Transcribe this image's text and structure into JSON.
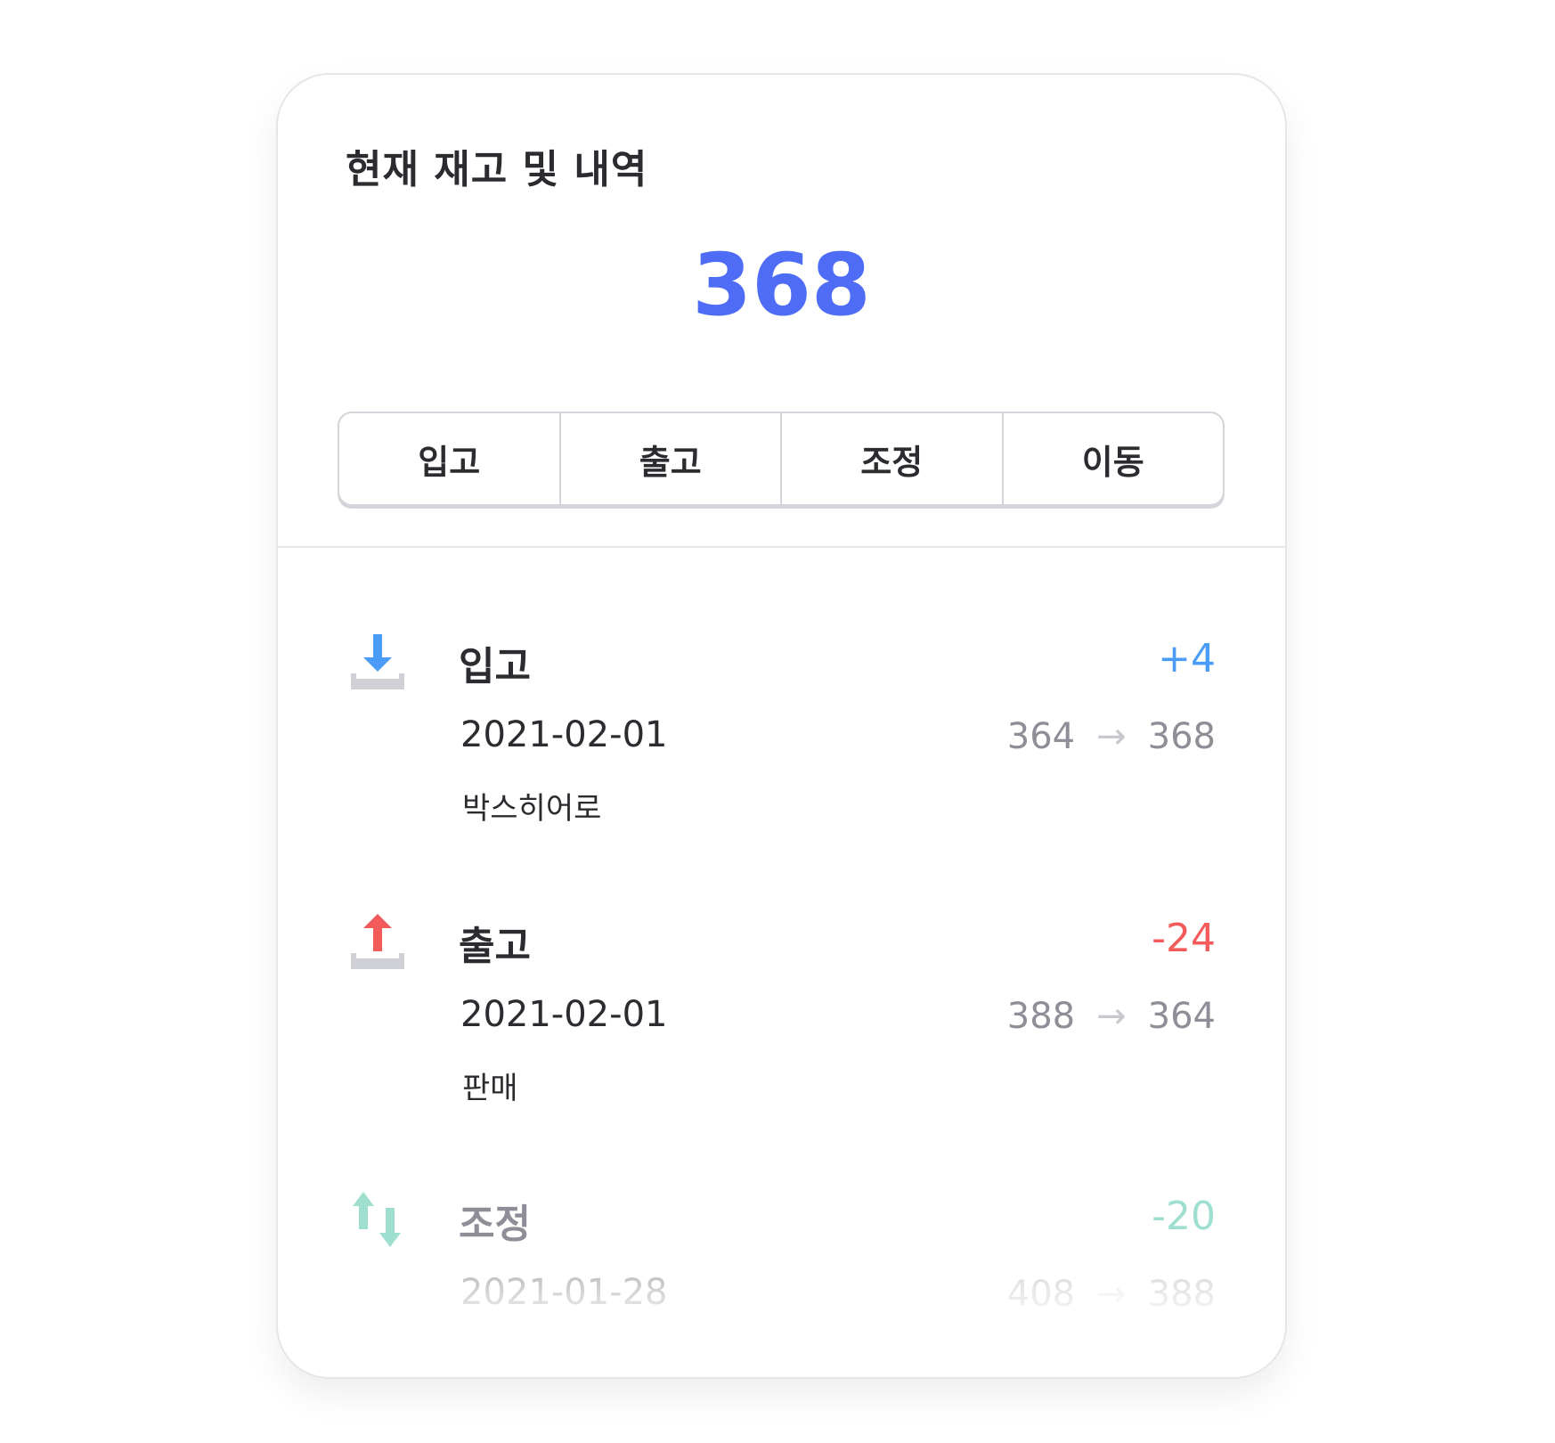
{
  "card": {
    "title": "현재 재고 및 내역",
    "current_stock": "368",
    "tabs": [
      "입고",
      "출고",
      "조정",
      "이동"
    ],
    "colors": {
      "accent": "#4e6cf5",
      "in": "#4a9cf6",
      "out": "#f35b5b",
      "adjust": "#9edfcf"
    },
    "history": [
      {
        "icon": "download-arrow-icon",
        "type": "입고",
        "amount": "+4",
        "date": "2021-02-01",
        "from": "364",
        "to": "368",
        "note": "박스히어로"
      },
      {
        "icon": "upload-arrow-icon",
        "type": "출고",
        "amount": "-24",
        "date": "2021-02-01",
        "from": "388",
        "to": "364",
        "note": "판매"
      },
      {
        "icon": "swap-arrows-icon",
        "type": "조정",
        "amount": "-20",
        "date": "2021-01-28",
        "from": "408",
        "to": "388"
      }
    ]
  }
}
